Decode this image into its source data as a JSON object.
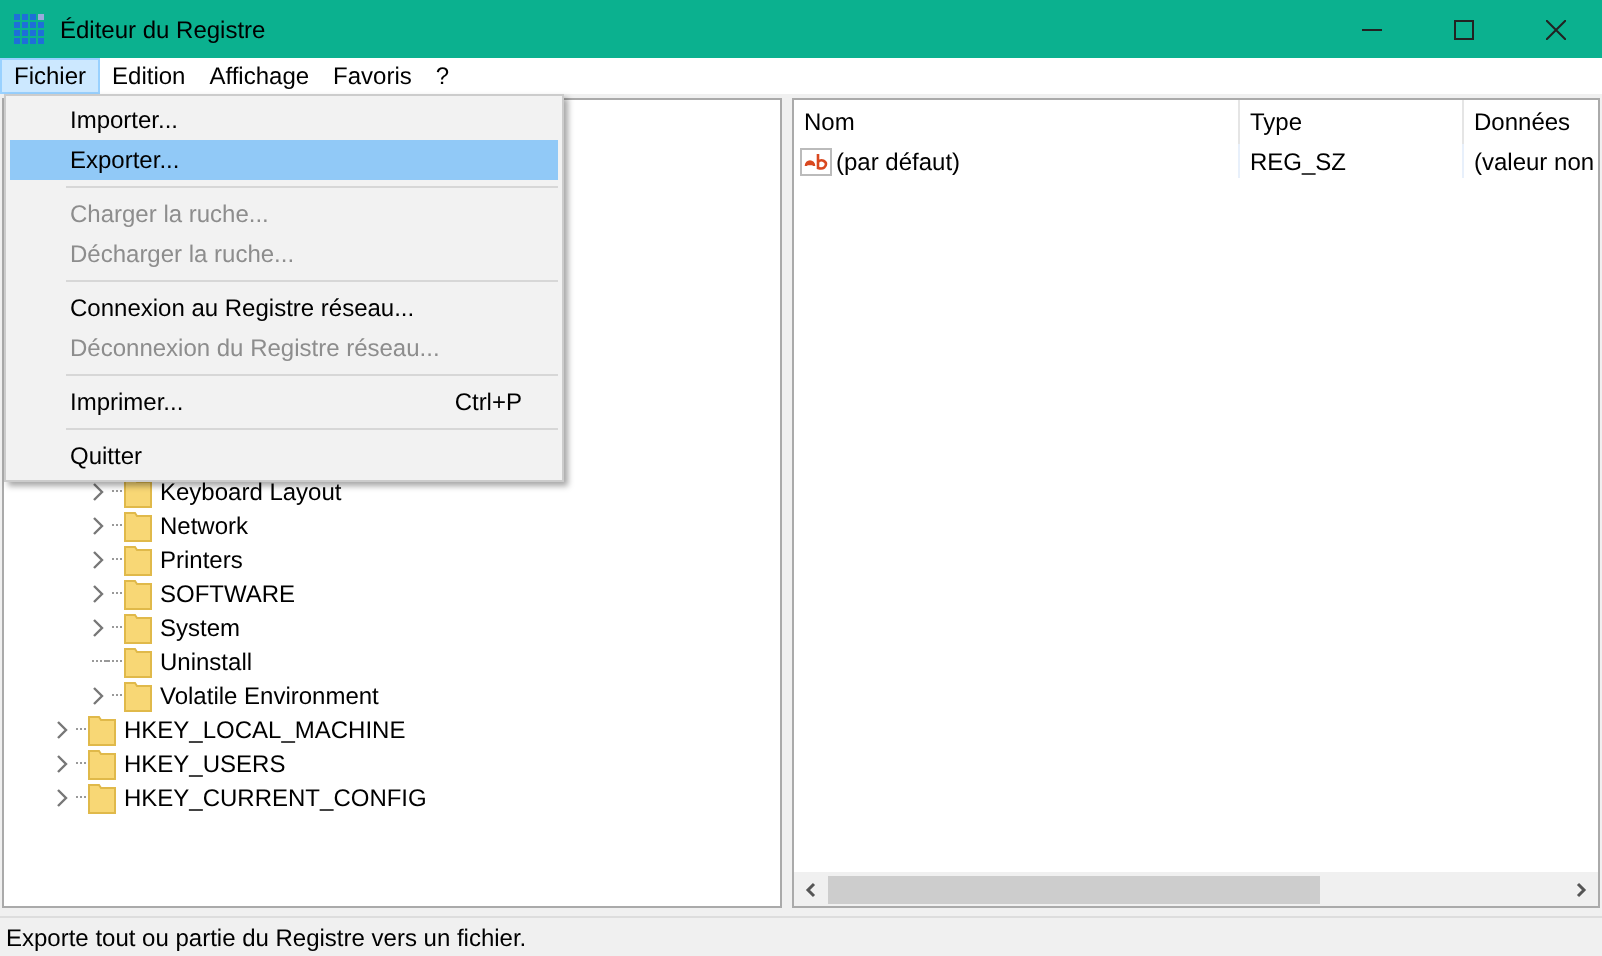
{
  "window": {
    "title": "Éditeur du Registre"
  },
  "menu_bar": [
    {
      "label": "Fichier",
      "selected": true
    },
    {
      "label": "Edition",
      "selected": false
    },
    {
      "label": "Affichage",
      "selected": false
    },
    {
      "label": "Favoris",
      "selected": false
    },
    {
      "label": "?",
      "selected": false
    }
  ],
  "file_menu": [
    {
      "kind": "item",
      "label": "Importer...",
      "selected": false,
      "disabled": false
    },
    {
      "kind": "item",
      "label": "Exporter...",
      "selected": true,
      "disabled": false
    },
    {
      "kind": "separator"
    },
    {
      "kind": "item",
      "label": "Charger la ruche...",
      "selected": false,
      "disabled": true
    },
    {
      "kind": "item",
      "label": "Décharger la ruche...",
      "selected": false,
      "disabled": true
    },
    {
      "kind": "separator"
    },
    {
      "kind": "item",
      "label": "Connexion au Registre réseau...",
      "selected": false,
      "disabled": false
    },
    {
      "kind": "item",
      "label": "Déconnexion du Registre réseau...",
      "selected": false,
      "disabled": true
    },
    {
      "kind": "separator"
    },
    {
      "kind": "item",
      "label": "Imprimer...",
      "shortcut": "Ctrl+P",
      "selected": false,
      "disabled": false
    },
    {
      "kind": "separator"
    },
    {
      "kind": "item",
      "label": "Quitter",
      "selected": false,
      "disabled": false
    }
  ],
  "tree": [
    {
      "children": [
        {
          "label": "Keyboard Layout",
          "expandable": true
        },
        {
          "label": "Network",
          "expandable": true
        },
        {
          "label": "Printers",
          "expandable": true
        },
        {
          "label": "SOFTWARE",
          "expandable": true
        },
        {
          "label": "System",
          "expandable": true
        },
        {
          "label": "Uninstall",
          "expandable": false
        },
        {
          "label": "Volatile Environment",
          "expandable": true
        }
      ]
    },
    {
      "label": "HKEY_LOCAL_MACHINE",
      "expandable": true
    },
    {
      "label": "HKEY_USERS",
      "expandable": true
    },
    {
      "label": "HKEY_CURRENT_CONFIG",
      "expandable": true
    }
  ],
  "values_table": {
    "columns": [
      "Nom",
      "Type",
      "Données"
    ],
    "rows": [
      {
        "name": "(par défaut)",
        "type": "REG_SZ",
        "data": "(valeur non"
      }
    ]
  },
  "status_bar": "Exporte tout ou partie du Registre vers un fichier."
}
